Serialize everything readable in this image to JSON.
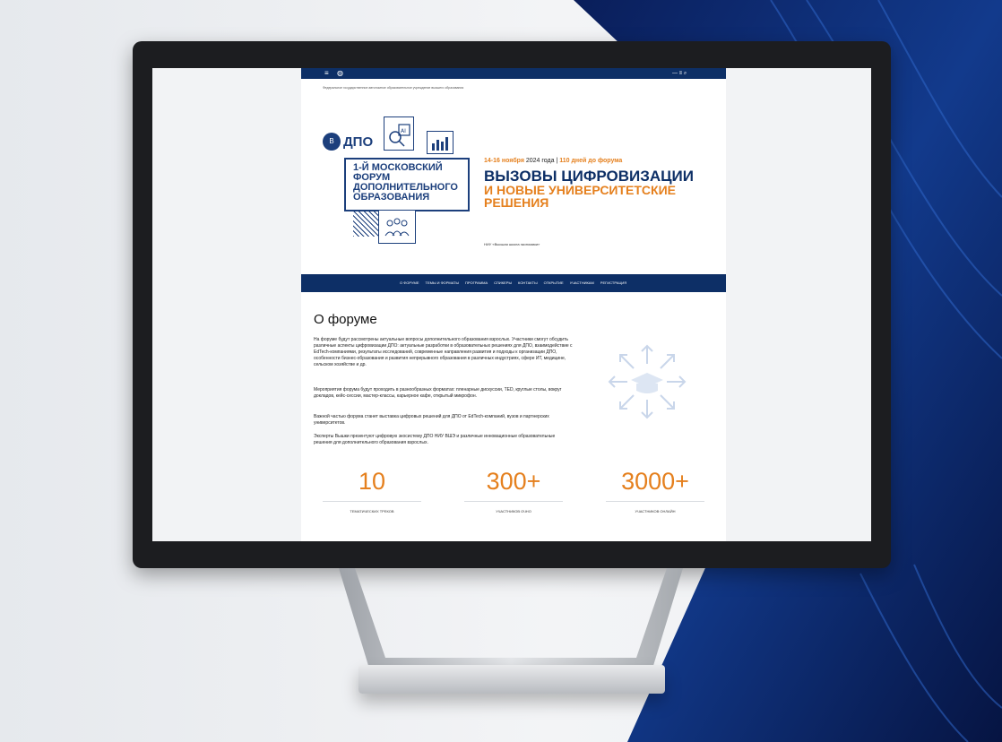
{
  "page": {
    "subheader": "Федеральное государственное автономное образовательное учреждение высшего образования",
    "topbar_icon_left": "≡",
    "topbar_icon_right": "—  ≡  ⌕"
  },
  "hero": {
    "logo_text": "ДПО",
    "forum_title": "1-Й МОСКОВСКИЙ ФОРУМ ДОПОЛНИТЕЛЬНОГО ОБРАЗОВАНИЯ",
    "date_highlight": "14-16 ноября",
    "date_rest": " 2024 года",
    "separator": " | ",
    "days_left": "110 дней до форума",
    "headline_line1": "ВЫЗОВЫ ЦИФРОВИЗАЦИИ",
    "headline_line2": "И НОВЫЕ УНИВЕРСИТЕТСКИЕ РЕШЕНИЯ",
    "venue": "НИУ «Высшая школа экономики»"
  },
  "nav": {
    "items": [
      "О ФОРУМЕ",
      "ТЕМЫ И ФОРМАТЫ",
      "ПРОГРАММА",
      "СПИКЕРЫ",
      "КОНТАКТЫ",
      "ОТКРЫТИЕ",
      "УЧАСТНИКАМ",
      "РЕГИСТРАЦИЯ"
    ]
  },
  "about": {
    "title": "О форуме",
    "paragraphs": [
      "На форуме будут рассмотрены актуальные вопросы дополнительного образования взрослых. Участники смогут обсудить различные аспекты цифровизации ДПО: актуальные разработки в образовательных решениях для ДПО, взаимодействие с EdTech-компаниями, результаты исследований, современные направления развития и подходы к организации ДПО, особенности бизнес-образования и развития непрерывного образования в различных индустриях, сфере ИТ, медицине, сельском хозяйстве и др.",
      "Мероприятия форума будут проходить в разнообразных форматах: пленарные дискуссии, ТЕD, круглые столы, вокруг докладов, кейс-сессии, мастер-классы, карьерное кафе, открытый микрофон.",
      "Важной частью форума станет выставка цифровых решений для ДПО от EdTech-компаний, вузов и партнерских университетов.",
      "Эксперты Вышки презентуют цифровую экосистему ДПО НИУ ВШЭ и различные инновационные образовательные решения для дополнительного образования взрослых."
    ]
  },
  "stats": [
    {
      "value": "10",
      "label": "ТЕМАТИЧЕСКИХ ТРЕКОВ"
    },
    {
      "value": "300+",
      "label": "УЧАСТНИКОВ ОЧНО"
    },
    {
      "value": "3000+",
      "label": "УЧАСТНИКОВ ОНЛАЙН"
    }
  ],
  "colors": {
    "navy": "#0d2f66",
    "orange": "#e5801e"
  }
}
